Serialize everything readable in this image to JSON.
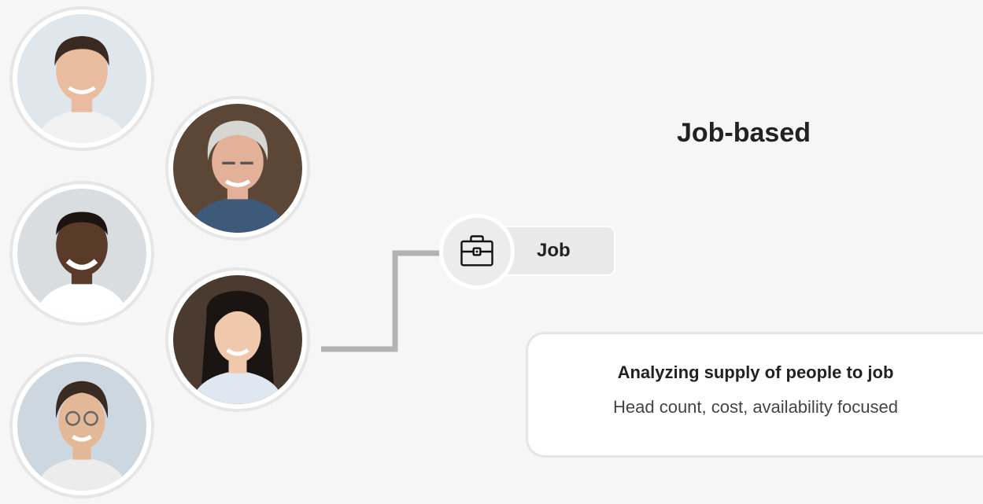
{
  "diagram": {
    "title": "Job-based",
    "node": {
      "label": "Job",
      "icon": "briefcase-icon"
    },
    "card": {
      "heading": "Analyzing supply of people to job",
      "subtext": "Head count, cost, availability focused"
    },
    "people": [
      {
        "name": "person-1-avatar",
        "bg": "#dfe6ec",
        "skin": "#e9bca0",
        "hair": "#3a2a22",
        "shirt": "#f2f2f2"
      },
      {
        "name": "person-2-avatar",
        "bg": "#5c4636",
        "skin": "#e2b198",
        "hair": "#d6d6d2",
        "shirt": "#3d5a7a"
      },
      {
        "name": "person-3-avatar",
        "bg": "#d9dde0",
        "skin": "#5a3a28",
        "hair": "#1c1410",
        "shirt": "#ffffff"
      },
      {
        "name": "person-4-avatar",
        "bg": "#4a3a30",
        "skin": "#f0c9ad",
        "hair": "#1a1412",
        "shirt": "#dfe8f0"
      },
      {
        "name": "person-5-avatar",
        "bg": "#cdd7e0",
        "skin": "#e3b896",
        "hair": "#3b2a20",
        "shirt": "#ececec"
      }
    ],
    "colors": {
      "background": "#f6f6f6",
      "connector": "#b3b3b3",
      "pill": "#e9e9e9",
      "text": "#222222"
    }
  }
}
